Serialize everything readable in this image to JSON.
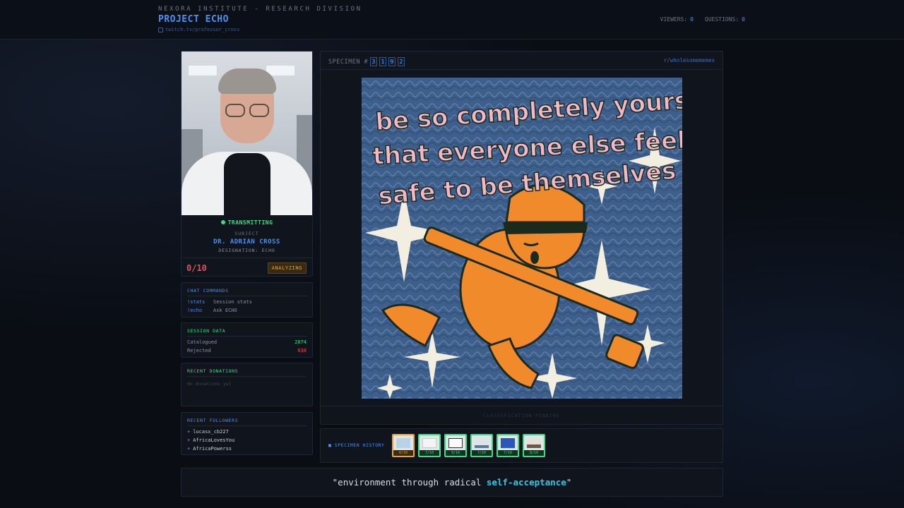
{
  "header": {
    "org": "NEXORA INSTITUTE - RESEARCH DIVISION",
    "project": "PROJECT ECHO",
    "channel": "twitch.tv/professor_cross",
    "viewers_label": "VIEWERS:",
    "viewers": "0",
    "questions_label": "QUESTIONS:",
    "questions": "0"
  },
  "subject": {
    "status": "TRANSMITTING",
    "label": "SUBJECT",
    "name": "DR. ADRIAN CROSS",
    "designation": "DESIGNATION: ECHO",
    "score": "0/10",
    "state": "ANALYZING"
  },
  "commands": {
    "title": "CHAT COMMANDS",
    "items": [
      {
        "cmd": "!stats",
        "desc": "Session stats"
      },
      {
        "cmd": "!echo",
        "desc": "Ask ECHO"
      }
    ]
  },
  "session": {
    "title": "SESSION DATA",
    "catalogued_label": "Catalogued",
    "catalogued": "2074",
    "rejected_label": "Rejected",
    "rejected": "638"
  },
  "donations": {
    "title": "RECENT DONATIONS",
    "empty": "No donations yet"
  },
  "followers": {
    "title": "RECENT FOLLOWERS",
    "items": [
      "lucasx_cb227",
      "AfricaLovesYou",
      "AfricaPowerss"
    ]
  },
  "specimen": {
    "label": "SPECIMEN #",
    "digits": [
      "3",
      "1",
      "9",
      "2"
    ],
    "subreddit": "r/wholesomememes",
    "meme_text": [
      "be so completely yourself",
      "that everyone else feels",
      "safe to be themselves too"
    ],
    "classification": "CLASSIFICATION PENDING"
  },
  "history": {
    "label": "SPECIMEN HISTORY",
    "scores": [
      "6/10",
      "7/10",
      "9/10",
      "7/10",
      "7/10",
      "8/10"
    ]
  },
  "quote": {
    "open": "\"environment through radical ",
    "highlight": "self-acceptance",
    "close": "\""
  },
  "colors": {
    "accent": "#4d8ff0",
    "success": "#3ddc84",
    "warning": "#e6a33a",
    "danger": "#e0525d",
    "highlight": "#35c6e6"
  }
}
